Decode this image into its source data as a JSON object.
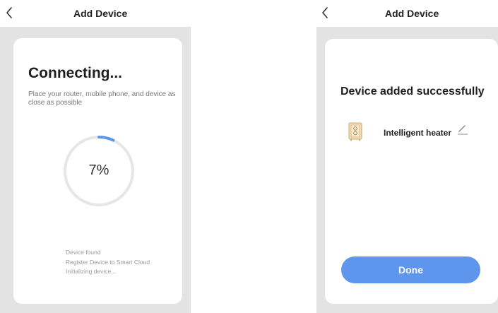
{
  "left": {
    "nav": {
      "title": "Add Device"
    },
    "card": {
      "title": "Connecting...",
      "hint": "Place your router, mobile phone, and device as close as possible",
      "progress": {
        "value": 0.07,
        "label": "7%"
      },
      "steps": [
        "Device found",
        "Register Device to Smart Cloud",
        "Initializing device..."
      ]
    }
  },
  "right": {
    "nav": {
      "title": "Add Device"
    },
    "card": {
      "title": "Device added successfully",
      "device": {
        "name": "Intelligent heater",
        "icon": "heater-icon"
      },
      "done_label": "Done"
    }
  },
  "colors": {
    "accent": "#5e96ee",
    "progress_track": "#e6e6e6",
    "background": "#e3e3e3"
  }
}
